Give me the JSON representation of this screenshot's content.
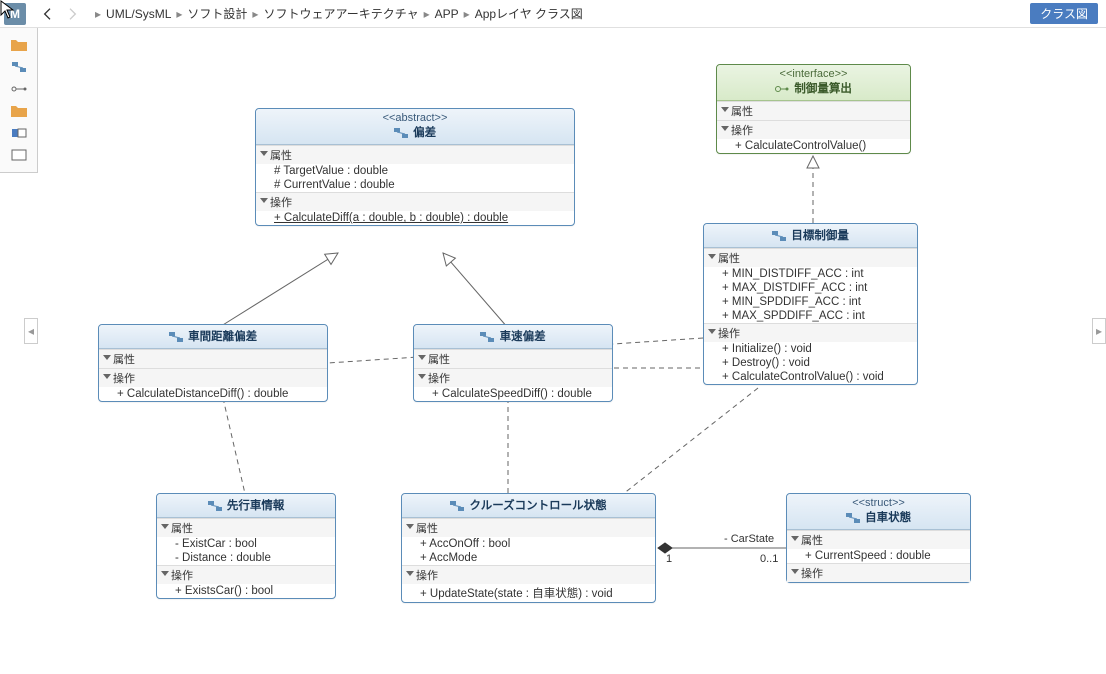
{
  "logo": "M",
  "breadcrumb": [
    "UML/SysML",
    "ソフト設計",
    "ソフトウェアアーキテクチャ",
    "APP",
    "Appレイヤ クラス図"
  ],
  "diagram_type_tag": "クラス図",
  "sections": {
    "attributes": "属性",
    "operations": "操作"
  },
  "classes": {
    "hensa": {
      "stereotype": "<<abstract>>",
      "name": "偏差",
      "attributes": [
        "# TargetValue : double",
        "# CurrentValue : double"
      ],
      "operations": [
        "+ CalculateDiff(a : double, b : double) : double"
      ]
    },
    "seigyoryo_if": {
      "stereotype": "<<interface>>",
      "name": "制御量算出",
      "attributes": [],
      "operations": [
        "+ CalculateControlValue()"
      ]
    },
    "shakan": {
      "name": "車間距離偏差",
      "attributes": [],
      "operations": [
        "+ CalculateDistanceDiff() : double"
      ]
    },
    "shasoku": {
      "name": "車速偏差",
      "attributes": [],
      "operations": [
        "+ CalculateSpeedDiff() : double"
      ]
    },
    "mokuhyou": {
      "name": "目標制御量",
      "attributes": [
        "+ MIN_DISTDIFF_ACC : int",
        "+ MAX_DISTDIFF_ACC : int",
        "+ MIN_SPDDIFF_ACC : int",
        "+ MAX_SPDDIFF_ACC : int"
      ],
      "operations": [
        "+ Initialize() : void",
        "+ Destroy() : void",
        "+ CalculateControlValue() : void"
      ]
    },
    "senko": {
      "name": "先行車情報",
      "attributes": [
        "- ExistCar : bool",
        "- Distance : double"
      ],
      "operations": [
        "+ ExistsCar() : bool"
      ]
    },
    "cruise": {
      "name": "クルーズコントロール状態",
      "attributes": [
        "+ AccOnOff : bool",
        "+ AccMode"
      ],
      "operations": [
        "+ UpdateState(state : 自車状態) : void"
      ]
    },
    "jisha": {
      "stereotype": "<<struct>>",
      "name": "自車状態",
      "attributes": [
        "+ CurrentSpeed : double"
      ],
      "operations": []
    }
  },
  "relation_labels": {
    "car_state_role": "- CarState",
    "left_mult": "1",
    "right_mult": "0..1"
  }
}
